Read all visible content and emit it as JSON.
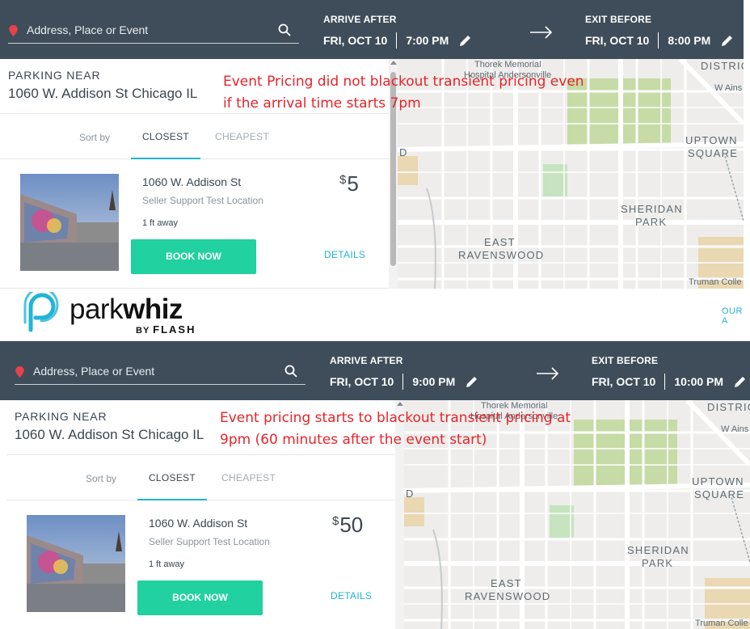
{
  "screenshots": [
    {
      "search": {
        "placeholder": "Address, Place or Event"
      },
      "arrive": {
        "label": "ARRIVE AFTER",
        "date": "FRI, OCT 10",
        "time": "7:00 PM"
      },
      "exit": {
        "label": "EXIT BEFORE",
        "date": "FRI, OCT 10",
        "time": "8:00 PM"
      },
      "parking_near": {
        "label": "PARKING NEAR",
        "address": "1060 W. Addison St Chicago IL"
      },
      "sort": {
        "label": "Sort by",
        "tabs": [
          "CLOSEST",
          "CHEAPEST"
        ],
        "active": "CLOSEST"
      },
      "listing": {
        "name": "1060 W. Addison St",
        "subtitle": "Seller Support Test Location",
        "distance": "1 ft away",
        "currency": "$",
        "price": "5",
        "book_label": "BOOK NOW",
        "details_label": "DETAILS"
      },
      "annotation": [
        "Event Pricing did not blackout transient pricing even",
        "if the arrival time starts 7pm"
      ],
      "map_labels": {
        "hospital": [
          "Thorek Memorial",
          "Hospital Andersonville"
        ],
        "district": "DISTRIC",
        "ainslie": "W Ains",
        "uptown": [
          "UPTOWN",
          "SQUARE"
        ],
        "sheridan": [
          "SHERIDAN",
          "PARK"
        ],
        "east_ravenswood": [
          "EAST",
          "RAVENSWOOD"
        ],
        "truman": "Truman Colle",
        "d_label": "D"
      }
    },
    {
      "search": {
        "placeholder": "Address, Place or Event"
      },
      "arrive": {
        "label": "ARRIVE AFTER",
        "date": "FRI, OCT 10",
        "time": "9:00 PM"
      },
      "exit": {
        "label": "EXIT BEFORE",
        "date": "FRI, OCT 10",
        "time": "10:00 PM"
      },
      "parking_near": {
        "label": "PARKING NEAR",
        "address": "1060 W. Addison St Chicago IL"
      },
      "sort": {
        "label": "Sort by",
        "tabs": [
          "CLOSEST",
          "CHEAPEST"
        ],
        "active": "CLOSEST"
      },
      "listing": {
        "name": "1060 W. Addison St",
        "subtitle": "Seller Support Test Location",
        "distance": "1 ft away",
        "currency": "$",
        "price": "50",
        "book_label": "BOOK NOW",
        "details_label": "DETAILS"
      },
      "annotation": [
        "Event pricing starts to blackout transient pricing at",
        "9pm (60 minutes after the event start)"
      ],
      "map_labels": {
        "hospital": [
          "Thorek Memorial",
          "Hospital Andersonville"
        ],
        "district": "DISTRIC",
        "ainslie": "W Ains",
        "uptown": [
          "UPTOWN",
          "SQUARE"
        ],
        "sheridan": [
          "SHERIDAN",
          "PARK"
        ],
        "east_ravenswood": [
          "EAST",
          "RAVENSWOOD"
        ],
        "truman": "Truman Colle",
        "d_label": "D"
      }
    }
  ],
  "brand": {
    "name_part1": "park",
    "name_part2": "whiz",
    "byline_prefix": "BY",
    "byline_brand": "FLASH",
    "nav_link": "OUR A"
  },
  "colors": {
    "header": "#3e4d59",
    "accent": "#21b4d6",
    "book": "#21d19f",
    "annotation": "#e8232a",
    "pin": "#e8404c"
  },
  "icons": [
    "map-pin-icon",
    "search-icon",
    "pencil-icon",
    "arrow-right-icon",
    "parkwhiz-logo-icon"
  ]
}
